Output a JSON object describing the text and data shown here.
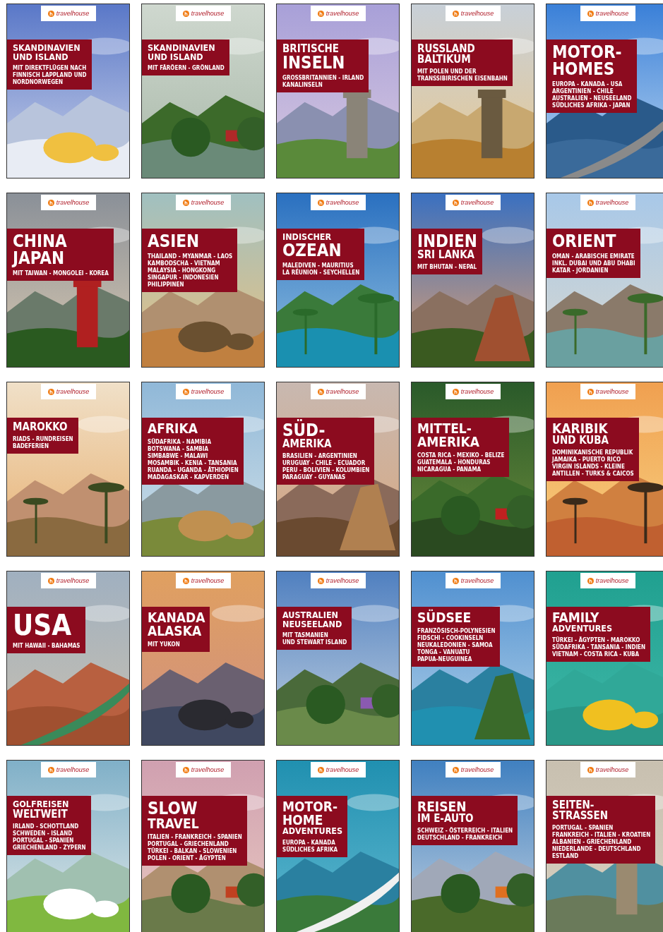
{
  "covers": [
    {
      "logo": "travelhouse",
      "title_lines": [
        {
          "text": "SKANDINAVIEN",
          "kind": "small"
        },
        {
          "text": "UND ISLAND",
          "kind": "small"
        }
      ],
      "subtitle": "MIT DIREKTFLÜGEN NACH\nFINNISCH LAPPLAND UND\nNORDNORWEGEN"
    },
    {
      "logo": "travelhouse",
      "title_lines": [
        {
          "text": "SKANDINAVIEN",
          "kind": "small"
        },
        {
          "text": "UND ISLAND",
          "kind": "small"
        }
      ],
      "subtitle": "MIT FÄRÖERN - GRÖNLAND"
    },
    {
      "logo": "travelhouse",
      "title_lines": [
        {
          "text": "BRITISCHE",
          "kind": "medium"
        },
        {
          "text": "INSELN",
          "kind": "large"
        }
      ],
      "subtitle": "GROSSBRITANNIEN - IRLAND\nKANALINSELN"
    },
    {
      "logo": "travelhouse",
      "title_lines": [
        {
          "text": "RUSSLAND",
          "kind": "medium"
        },
        {
          "text": "BALTIKUM",
          "kind": "medium"
        }
      ],
      "subtitle": "MIT POLEN UND DER\nTRANSSIBIRISCHEN EISENBAHN"
    },
    {
      "logo": "travelhouse",
      "title_lines": [
        {
          "text": "MOTOR-",
          "kind": "large"
        },
        {
          "text": "HOMES",
          "kind": "large"
        }
      ],
      "subtitle": "EUROPA - KANADA - USA\nARGENTINIEN - CHILE\nAUSTRALIEN - NEUSEELAND\nSÜDLICHES AFRIKA - JAPAN"
    },
    {
      "logo": "travelhouse",
      "title_lines": [
        {
          "text": "CHINA",
          "kind": "large"
        },
        {
          "text": "JAPAN",
          "kind": "large"
        }
      ],
      "subtitle": "MIT TAIWAN - MONGOLEI - KOREA"
    },
    {
      "logo": "travelhouse",
      "title_lines": [
        {
          "text": "ASIEN",
          "kind": "large"
        }
      ],
      "subtitle": "THAILAND - MYANMAR - LAOS\nKAMBODSCHA - VIETNAM\nMALAYSIA - HONGKONG\nSINGAPUR - INDONESIEN\nPHILIPPINEN"
    },
    {
      "logo": "travelhouse",
      "title_lines": [
        {
          "text": "INDISCHER",
          "kind": "small"
        },
        {
          "text": "OZEAN",
          "kind": "large"
        }
      ],
      "subtitle": "MALEDIVEN - MAURITIUS\nLA RÉUNION - SEYCHELLEN"
    },
    {
      "logo": "travelhouse",
      "title_lines": [
        {
          "text": "INDIEN",
          "kind": "large"
        },
        {
          "text": "SRI LANKA",
          "kind": "medium"
        }
      ],
      "subtitle": "MIT BHUTAN - NEPAL"
    },
    {
      "logo": "travelhouse",
      "title_lines": [
        {
          "text": "ORIENT",
          "kind": "large"
        }
      ],
      "subtitle": "OMAN - ARABISCHE EMIRATE\nINKL. DUBAI UND ABU DHABI\nKATAR - JORDANIEN"
    },
    {
      "logo": "travelhouse",
      "title_lines": [
        {
          "text": "MAROKKO",
          "kind": "medium"
        }
      ],
      "subtitle": "RIADS - RUNDREISEN\nBADEFERIEN"
    },
    {
      "logo": "travelhouse",
      "title_lines": [
        {
          "text": "AFRIKA",
          "kind": "big"
        }
      ],
      "subtitle": "SÜDAFRIKA - NAMIBIA\nBOTSWANA - SAMBIA\nSIMBABWE - MALAWI\nMOSAMBIK - KENIA - TANSANIA\nRUANDA - UGANDA - ÄTHIOPIEN\nMADAGASKAR - KAPVERDEN"
    },
    {
      "logo": "travelhouse",
      "title_lines": [
        {
          "text": "SÜD-",
          "kind": "large"
        },
        {
          "text": "AMERIKA",
          "kind": "medium"
        }
      ],
      "subtitle": "BRASILIEN - ARGENTINIEN\nURUGUAY - CHILE - ECUADOR\nPERU - BOLIVIEN - KOLUMBIEN\nPARAGUAY - GUYANAS"
    },
    {
      "logo": "travelhouse",
      "title_lines": [
        {
          "text": "MITTEL-",
          "kind": "big"
        },
        {
          "text": "AMERIKA",
          "kind": "big"
        }
      ],
      "subtitle": "COSTA RICA - MEXIKO - BELIZE\nGUATEMALA - HONDURAS\nNICARAGUA - PANAMA"
    },
    {
      "logo": "travelhouse",
      "title_lines": [
        {
          "text": "KARIBIK",
          "kind": "big"
        },
        {
          "text": "UND KUBA",
          "kind": "medium"
        }
      ],
      "subtitle": "DOMINIKANISCHE REPUBLIK\nJAMAIKA - PUERTO RICO\nVIRGIN ISLANDS - KLEINE\nANTILLEN - TURKS & CAICOS"
    },
    {
      "logo": "travelhouse",
      "title_lines": [
        {
          "text": "USA",
          "kind": "xl"
        }
      ],
      "subtitle": "MIT HAWAII - BAHAMAS"
    },
    {
      "logo": "travelhouse",
      "title_lines": [
        {
          "text": "KANADA",
          "kind": "big"
        },
        {
          "text": "ALASKA",
          "kind": "big"
        }
      ],
      "subtitle": "MIT YUKON"
    },
    {
      "logo": "travelhouse",
      "title_lines": [
        {
          "text": "AUSTRALIEN",
          "kind": "small"
        },
        {
          "text": "NEUSEELAND",
          "kind": "small"
        }
      ],
      "subtitle": "MIT TASMANIEN\nUND STEWART ISLAND"
    },
    {
      "logo": "travelhouse",
      "title_lines": [
        {
          "text": "SÜDSEE",
          "kind": "big"
        }
      ],
      "subtitle": "FRANZÖSISCH-POLYNESIEN\nFIDSCHI - COOKINSELN\nNEUKALEDONIEN - SAMOA\nTONGA - VANUATU\nPAPUA-NEUGUINEA"
    },
    {
      "logo": "travelhouse",
      "title_lines": [
        {
          "text": "FAMILY",
          "kind": "big"
        },
        {
          "text": "ADVENTURES",
          "kind": "small"
        }
      ],
      "subtitle": "TÜRKEI - ÄGYPTEN - MAROKKO\nSÜDAFRIKA - TANSANIA - INDIEN\nVIETNAM - COSTA RICA - KUBA"
    },
    {
      "logo": "travelhouse",
      "title_lines": [
        {
          "text": "GOLFREISEN",
          "kind": "small"
        },
        {
          "text": "WELTWEIT",
          "kind": "medium"
        }
      ],
      "subtitle": "IRLAND - SCHOTTLAND\nSCHWEDEN - ISLAND\nPORTUGAL - SPANIEN\nGRIECHENLAND - ZYPERN"
    },
    {
      "logo": "travelhouse",
      "title_lines": [
        {
          "text": "SLOW",
          "kind": "large"
        },
        {
          "text": "TRAVEL",
          "kind": "big"
        }
      ],
      "subtitle": "ITALIEN - FRANKREICH - SPANIEN\nPORTUGAL - GRIECHENLAND\nTÜRKEI - BALKAN - SLOWENIEN\nPOLEN - ORIENT - ÄGYPTEN"
    },
    {
      "logo": "travelhouse",
      "title_lines": [
        {
          "text": "MOTOR-",
          "kind": "big"
        },
        {
          "text": "HOME",
          "kind": "big"
        },
        {
          "text": "ADVENTURES",
          "kind": "small"
        }
      ],
      "subtitle": "EUROPA - KANADA\nSÜDLICHES AFRIKA"
    },
    {
      "logo": "travelhouse",
      "title_lines": [
        {
          "text": "REISEN",
          "kind": "big"
        },
        {
          "text": "IM E-AUTO",
          "kind": "medium"
        }
      ],
      "subtitle": "SCHWEIZ - ÖSTERREICH - ITALIEN\nDEUTSCHLAND - FRANKREICH"
    },
    {
      "logo": "travelhouse",
      "title_lines": [
        {
          "text": "SEITEN-",
          "kind": "medium"
        },
        {
          "text": "STRASSEN",
          "kind": "medium"
        }
      ],
      "subtitle": "PORTUGAL - SPANIEN\nFRANKREICH - ITALIEN - KROATIEN\nALBANIEN - GRIECHENLAND\nNIEDERLANDE - DEUTSCHLAND\nESTLAND"
    }
  ]
}
